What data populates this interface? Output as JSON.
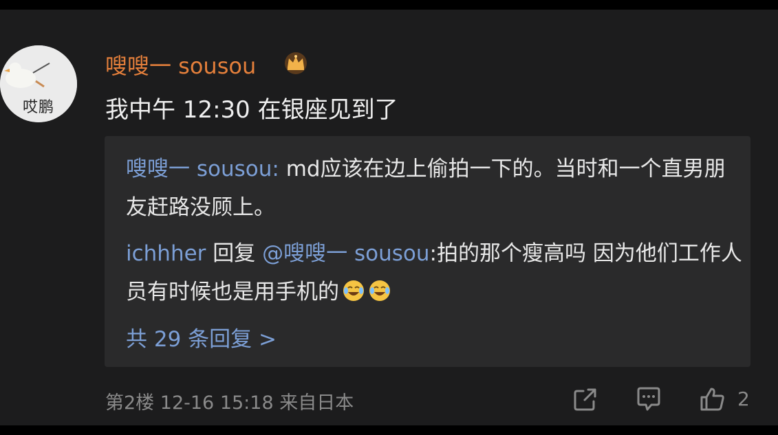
{
  "comment": {
    "avatar_text": "哎鹏",
    "username": "嗖嗖一 sousou",
    "badge_icon": "crown-icon",
    "text": "我中午 12:30 在银座见到了"
  },
  "replies": [
    {
      "author": "嗖嗖一 sousou",
      "separator": ": ",
      "text": "md应该在边上偷拍一下的。当时和一个直男朋友赶路没顾上。"
    },
    {
      "author": "ichhher",
      "reply_word": " 回复 ",
      "mention": "@嗖嗖一 sousou",
      "separator": ":",
      "text": "拍的那个瘦高吗 因为他们工作人员有时候也是用手机的",
      "emojis": [
        "laugh-cry-emoji",
        "laugh-cry-emoji"
      ]
    }
  ],
  "more_replies": "共 29 条回复 >",
  "meta": {
    "floor": "第2楼",
    "timestamp": "12-16 15:18",
    "location": "来自日本"
  },
  "actions": {
    "share_icon": "share-icon",
    "comment_icon": "comment-icon",
    "like_icon": "thumbs-up-icon",
    "like_count": "2"
  },
  "colors": {
    "username": "#e47f3b",
    "link": "#7c9fd6",
    "background": "#1c1c1d",
    "reply_box": "#2a2a2b"
  }
}
